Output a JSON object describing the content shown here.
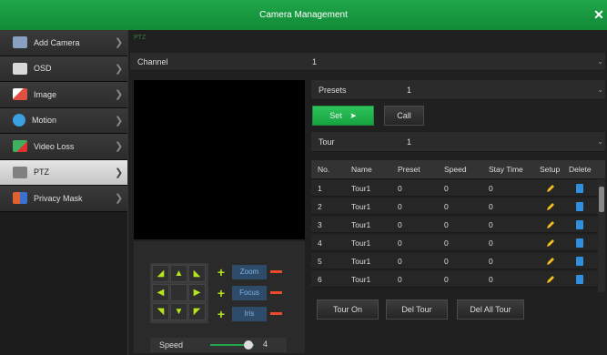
{
  "window": {
    "title": "Camera Management",
    "close_label": "✕"
  },
  "sidebar": {
    "items": [
      {
        "label": "Add Camera",
        "icon": "add-camera-icon",
        "color": "#8aa0c0"
      },
      {
        "label": "OSD",
        "icon": "osd-icon",
        "color": "#d9d9d9"
      },
      {
        "label": "Image",
        "icon": "image-icon",
        "color": "#e05040"
      },
      {
        "label": "Motion",
        "icon": "motion-icon",
        "color": "#3aa0e0"
      },
      {
        "label": "Video Loss",
        "icon": "video-loss-icon",
        "color": "#40b060"
      },
      {
        "label": "PTZ",
        "icon": "ptz-icon",
        "color": "#808080",
        "active": true
      },
      {
        "label": "Privacy Mask",
        "icon": "privacy-mask-icon",
        "color": "#e06030"
      }
    ]
  },
  "main": {
    "section_title": "PTZ",
    "channel": {
      "label": "Channel",
      "value": "1"
    },
    "presets": {
      "label": "Presets",
      "value": "1"
    },
    "set_label": "Set",
    "call_label": "Call",
    "tour": {
      "label": "Tour",
      "value": "1"
    },
    "controls": {
      "zoom": "Zoom",
      "focus": "Focus",
      "iris": "Iris"
    },
    "speed": {
      "label": "Speed",
      "value": "4"
    },
    "buttons": {
      "tour_on": "Tour On",
      "del_tour": "Del Tour",
      "del_all_tour": "Del All Tour"
    }
  },
  "table": {
    "headers": [
      "No.",
      "Name",
      "Preset",
      "Speed",
      "Stay Time",
      "Setup",
      "Delete"
    ],
    "rows": [
      [
        "1",
        "Tour1",
        "0",
        "0",
        "0"
      ],
      [
        "2",
        "Tour1",
        "0",
        "0",
        "0"
      ],
      [
        "3",
        "Tour1",
        "0",
        "0",
        "0"
      ],
      [
        "4",
        "Tour1",
        "0",
        "0",
        "0"
      ],
      [
        "5",
        "Tour1",
        "0",
        "0",
        "0"
      ],
      [
        "6",
        "Tour1",
        "0",
        "0",
        "0"
      ]
    ]
  },
  "colors": {
    "accent": "#1fa64a",
    "arrow": "#b5e61d",
    "minus": "#e84a2a",
    "trash": "#2f8fe0",
    "pencil": "#f0c020"
  }
}
